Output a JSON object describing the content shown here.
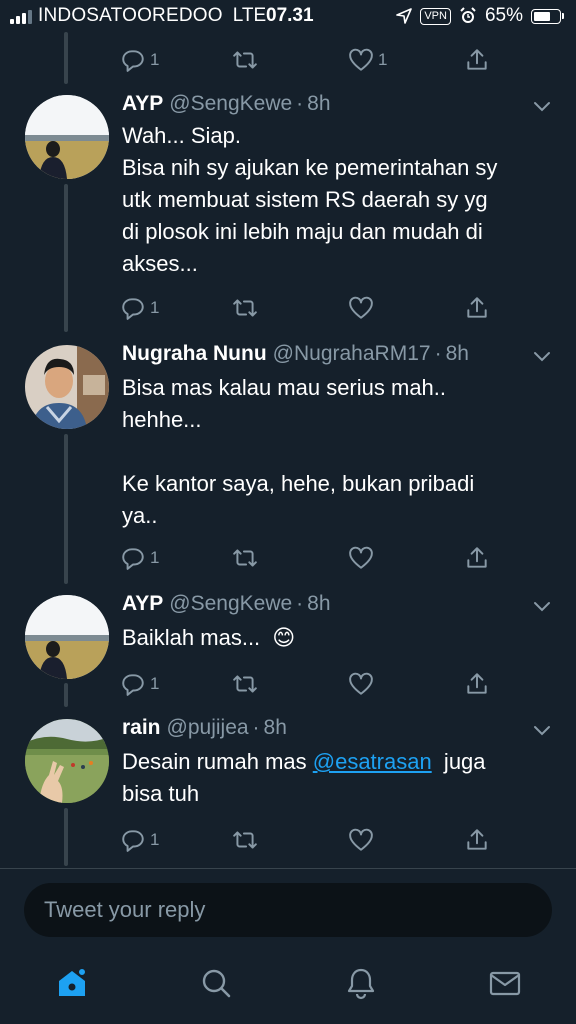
{
  "status_bar": {
    "carrier": "INDOSATOOREDOO",
    "network": "LTE",
    "time": "07.31",
    "vpn": "VPN",
    "battery_percent": "65%",
    "battery_level": 0.65
  },
  "colors": {
    "background": "#15202b",
    "accent": "#1da1f2",
    "muted": "#8899a6",
    "divider": "#38444d"
  },
  "top_actions": {
    "reply_count": "1",
    "like_count": "1"
  },
  "tweets": [
    {
      "name": "AYP",
      "handle": "@SengKewe",
      "time": "8h",
      "text_lines": [
        "Wah... Siap.",
        "Bisa nih sy ajukan ke pemerintahan sy",
        "utk membuat sistem RS daerah sy yg",
        "di plosok ini lebih maju dan mudah di",
        "akses..."
      ],
      "reply_count": "1"
    },
    {
      "name": "Nugraha Nunu",
      "handle": "@NugrahaRM17",
      "time": "8h",
      "text_lines": [
        "Bisa mas kalau mau serius mah..",
        "hehhe...",
        "",
        "Ke kantor saya, hehe, bukan pribadi",
        "ya.."
      ],
      "reply_count": "1"
    },
    {
      "name": "AYP",
      "handle": "@SengKewe",
      "time": "8h",
      "text": "Baiklah mas...",
      "emoji": "😊",
      "reply_count": "1"
    },
    {
      "name": "rain",
      "handle": "@pujijea",
      "time": "8h",
      "text_before": "Desain rumah mas ",
      "mention": "@esatrasan",
      "text_after": "  juga",
      "text_line2": "bisa tuh",
      "reply_count": "1"
    }
  ],
  "reply_box": {
    "placeholder": "Tweet your reply"
  },
  "tab_bar": {
    "items": [
      "home-icon",
      "search-icon",
      "notifications-icon",
      "messages-icon"
    ],
    "active": "home-icon"
  }
}
